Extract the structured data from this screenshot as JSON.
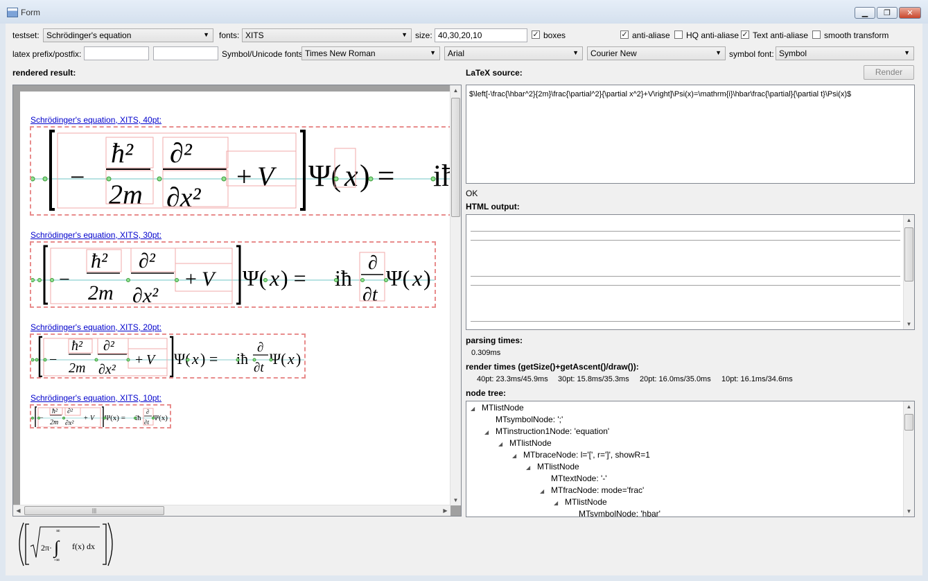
{
  "window": {
    "title": "Form"
  },
  "toolbar": {
    "testset_label": "testset:",
    "testset_value": "Schrödinger's equation",
    "fonts_label": "fonts:",
    "fonts_value": "XITS",
    "size_label": "size:",
    "size_value": "40,30,20,10",
    "boxes_label": "boxes",
    "antialiase_label": "anti-aliase",
    "hq_antialiase_label": "HQ anti-aliase",
    "text_antialiase_label": "Text anti-aliase",
    "smooth_transform_label": "smooth transform",
    "prefix_label": "latex prefix/postfix:",
    "prefix_value": "",
    "postfix_value": "",
    "symbol_fonts_label": "Symbol/Unicode fonts:",
    "font_roman": "Times New Roman",
    "font_sans": "Arial",
    "font_mono": "Courier New",
    "symbol_font_label": "symbol font:",
    "symbol_font_value": "Symbol",
    "checks": {
      "boxes": true,
      "antialiase": true,
      "hq": false,
      "text": true,
      "smooth": false
    }
  },
  "left": {
    "heading": "rendered result:",
    "renders": [
      {
        "caption": "Schrödinger's equation, XITS, 40pt:"
      },
      {
        "caption": "Schrödinger's equation, XITS, 30pt:"
      },
      {
        "caption": "Schrödinger's equation, XITS, 20pt:"
      },
      {
        "caption": "Schrödinger's equation, XITS, 10pt:"
      }
    ]
  },
  "right": {
    "latex_heading": "LaTeX source:",
    "render_button": "Render",
    "latex_source": "$\\left[-\\frac{\\hbar^2}{2m}\\frac{\\partial^2}{\\partial x^2}+V\\right]\\Psi(x)=\\mathrm{i}\\hbar\\frac{\\partial}{\\partial t}\\Psi(x)$",
    "status": "OK",
    "html_heading": "HTML output:",
    "parsing_heading": "parsing times:",
    "parsing_value": "0.309ms",
    "render_times_heading": "render times (getSize()+getAscent()/draw()):",
    "render_times": [
      "40pt: 23.3ms/45.9ms",
      "30pt: 15.8ms/35.3ms",
      "20pt: 16.0ms/35.0ms",
      "10pt: 16.1ms/34.6ms"
    ],
    "tree_heading": "node tree:",
    "tree": [
      {
        "text": "MTlistNode",
        "level": 0,
        "expander": true
      },
      {
        "text": "MTsymbolNode: ';'",
        "level": 1,
        "expander": false
      },
      {
        "text": "MTinstruction1Node: 'equation'",
        "level": 1,
        "expander": true
      },
      {
        "text": "MTlistNode",
        "level": 2,
        "expander": true
      },
      {
        "text": "MTbraceNode: l='[', r=']', showR=1",
        "level": 3,
        "expander": true
      },
      {
        "text": "MTlistNode",
        "level": 4,
        "expander": true
      },
      {
        "text": "MTtextNode: '-'",
        "level": 5,
        "expander": false
      },
      {
        "text": "MTfracNode: mode='frac'",
        "level": 5,
        "expander": true
      },
      {
        "text": "MTlistNode",
        "level": 6,
        "expander": true
      },
      {
        "text": "MTsymbolNode: 'hbar'",
        "level": 7,
        "expander": false
      }
    ]
  },
  "preview": {
    "formula_label": "2π·∫ f(x) dx",
    "integral_upper": "∞",
    "integral_lower": "-∞"
  }
}
